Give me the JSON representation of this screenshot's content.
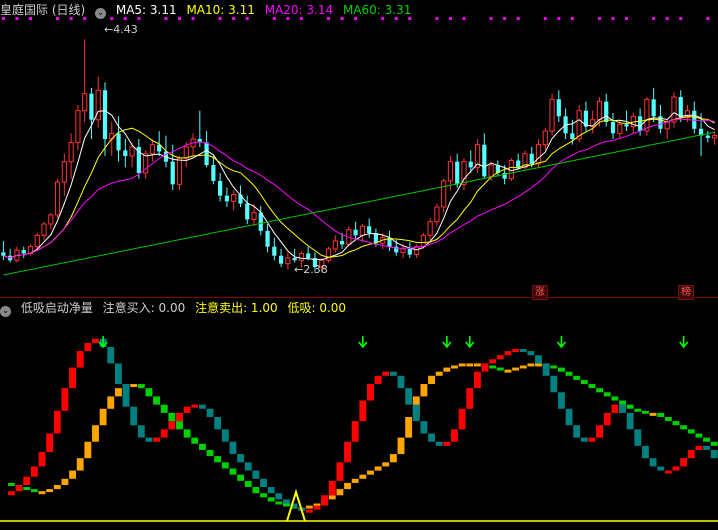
{
  "top_header": {
    "stock_title": "皇庭国际 (日线)",
    "ma5": "MA5: 3.11",
    "ma10": "MA10: 3.11",
    "ma20": "MA20: 3.14",
    "ma60": "MA60: 3.31"
  },
  "bottom_header": {
    "indicator_title": "低吸启动净量",
    "attention_buy": "注意买入: 0.00",
    "attention_sell": "注意卖出: 1.00",
    "low_buy": "低吸: 0.00"
  },
  "annotations": {
    "high_label": "4.43",
    "low_label": "2.38",
    "tag_zhang": "涨",
    "tag_bang": "榜"
  },
  "colors": {
    "up": "#ff3232",
    "down": "#54ffff",
    "ma5": "#ffffff",
    "ma10": "#ffff00",
    "ma20": "#ff00ff",
    "ma60": "#00c000",
    "bg": "#000000",
    "osc_red": "#ff0000",
    "osc_orange": "#ffa500",
    "osc_teal": "#008080",
    "osc_green": "#00d000",
    "arrow": "#00ff00",
    "baseline": "#ffff00"
  },
  "chart_data": [
    {
      "type": "candlestick",
      "ylim": [
        2.2,
        4.6
      ],
      "ma_periods": [
        5,
        10,
        20,
        60
      ],
      "ma_latest": {
        "MA5": 3.11,
        "MA10": 3.11,
        "MA20": 3.14,
        "MA60": 3.31
      },
      "ohlc": [
        [
          2.55,
          2.65,
          2.48,
          2.52
        ],
        [
          2.52,
          2.58,
          2.46,
          2.48
        ],
        [
          2.48,
          2.6,
          2.46,
          2.57
        ],
        [
          2.57,
          2.6,
          2.5,
          2.54
        ],
        [
          2.54,
          2.62,
          2.52,
          2.6
        ],
        [
          2.6,
          2.72,
          2.58,
          2.7
        ],
        [
          2.7,
          2.82,
          2.66,
          2.8
        ],
        [
          2.8,
          2.9,
          2.75,
          2.88
        ],
        [
          2.88,
          3.2,
          2.85,
          3.17
        ],
        [
          3.17,
          3.42,
          3.05,
          3.35
        ],
        [
          3.35,
          3.6,
          3.2,
          3.52
        ],
        [
          3.52,
          3.85,
          3.45,
          3.8
        ],
        [
          3.8,
          4.43,
          3.7,
          3.95
        ],
        [
          3.95,
          4.0,
          3.55,
          3.72
        ],
        [
          3.72,
          4.1,
          3.65,
          3.98
        ],
        [
          3.98,
          4.05,
          3.4,
          3.55
        ],
        [
          3.55,
          3.7,
          3.4,
          3.6
        ],
        [
          3.6,
          3.75,
          3.35,
          3.45
        ],
        [
          3.45,
          3.55,
          3.3,
          3.4
        ],
        [
          3.4,
          3.52,
          3.3,
          3.48
        ],
        [
          3.48,
          3.55,
          3.2,
          3.25
        ],
        [
          3.25,
          3.45,
          3.2,
          3.42
        ],
        [
          3.42,
          3.55,
          3.35,
          3.5
        ],
        [
          3.5,
          3.62,
          3.4,
          3.44
        ],
        [
          3.44,
          3.58,
          3.3,
          3.35
        ],
        [
          3.35,
          3.5,
          3.1,
          3.15
        ],
        [
          3.15,
          3.4,
          3.1,
          3.38
        ],
        [
          3.38,
          3.52,
          3.3,
          3.48
        ],
        [
          3.48,
          3.6,
          3.4,
          3.55
        ],
        [
          3.55,
          3.8,
          3.48,
          3.52
        ],
        [
          3.52,
          3.62,
          3.3,
          3.32
        ],
        [
          3.32,
          3.4,
          3.15,
          3.18
        ],
        [
          3.18,
          3.25,
          3.0,
          3.05
        ],
        [
          3.05,
          3.12,
          2.95,
          3.0
        ],
        [
          3.0,
          3.1,
          2.92,
          3.06
        ],
        [
          3.06,
          3.14,
          2.95,
          2.98
        ],
        [
          2.98,
          3.05,
          2.8,
          2.84
        ],
        [
          2.84,
          2.98,
          2.78,
          2.9
        ],
        [
          2.9,
          2.96,
          2.7,
          2.74
        ],
        [
          2.74,
          2.8,
          2.55,
          2.6
        ],
        [
          2.6,
          2.68,
          2.48,
          2.52
        ],
        [
          2.52,
          2.58,
          2.42,
          2.45
        ],
        [
          2.45,
          2.55,
          2.4,
          2.5
        ],
        [
          2.5,
          2.58,
          2.46,
          2.48
        ],
        [
          2.48,
          2.56,
          2.42,
          2.54
        ],
        [
          2.54,
          2.6,
          2.48,
          2.5
        ],
        [
          2.5,
          2.55,
          2.38,
          2.42
        ],
        [
          2.42,
          2.5,
          2.38,
          2.48
        ],
        [
          2.48,
          2.6,
          2.46,
          2.58
        ],
        [
          2.58,
          2.7,
          2.55,
          2.65
        ],
        [
          2.65,
          2.72,
          2.58,
          2.62
        ],
        [
          2.62,
          2.78,
          2.6,
          2.75
        ],
        [
          2.75,
          2.82,
          2.66,
          2.7
        ],
        [
          2.7,
          2.8,
          2.64,
          2.78
        ],
        [
          2.78,
          2.85,
          2.68,
          2.72
        ],
        [
          2.72,
          2.76,
          2.6,
          2.63
        ],
        [
          2.63,
          2.72,
          2.58,
          2.68
        ],
        [
          2.68,
          2.74,
          2.56,
          2.6
        ],
        [
          2.6,
          2.66,
          2.52,
          2.55
        ],
        [
          2.55,
          2.62,
          2.5,
          2.58
        ],
        [
          2.58,
          2.64,
          2.5,
          2.53
        ],
        [
          2.53,
          2.62,
          2.5,
          2.6
        ],
        [
          2.6,
          2.72,
          2.58,
          2.7
        ],
        [
          2.7,
          2.85,
          2.66,
          2.82
        ],
        [
          2.82,
          2.98,
          2.78,
          2.95
        ],
        [
          2.95,
          3.2,
          2.9,
          3.18
        ],
        [
          3.18,
          3.4,
          3.1,
          3.35
        ],
        [
          3.35,
          3.42,
          3.12,
          3.15
        ],
        [
          3.15,
          3.38,
          3.1,
          3.35
        ],
        [
          3.35,
          3.45,
          3.25,
          3.3
        ],
        [
          3.3,
          3.55,
          3.25,
          3.5
        ],
        [
          3.5,
          3.6,
          3.2,
          3.22
        ],
        [
          3.22,
          3.35,
          3.18,
          3.32
        ],
        [
          3.32,
          3.36,
          3.22,
          3.25
        ],
        [
          3.25,
          3.32,
          3.15,
          3.2
        ],
        [
          3.2,
          3.38,
          3.18,
          3.36
        ],
        [
          3.36,
          3.42,
          3.28,
          3.3
        ],
        [
          3.3,
          3.45,
          3.28,
          3.42
        ],
        [
          3.42,
          3.48,
          3.3,
          3.33
        ],
        [
          3.33,
          3.55,
          3.3,
          3.5
        ],
        [
          3.5,
          3.65,
          3.45,
          3.62
        ],
        [
          3.62,
          3.95,
          3.58,
          3.9
        ],
        [
          3.9,
          3.98,
          3.7,
          3.75
        ],
        [
          3.75,
          3.82,
          3.55,
          3.6
        ],
        [
          3.6,
          3.72,
          3.5,
          3.55
        ],
        [
          3.55,
          3.85,
          3.52,
          3.8
        ],
        [
          3.8,
          3.88,
          3.62,
          3.66
        ],
        [
          3.66,
          3.8,
          3.6,
          3.72
        ],
        [
          3.72,
          3.92,
          3.66,
          3.88
        ],
        [
          3.88,
          3.95,
          3.66,
          3.7
        ],
        [
          3.7,
          3.78,
          3.55,
          3.6
        ],
        [
          3.6,
          3.72,
          3.55,
          3.68
        ],
        [
          3.68,
          3.8,
          3.62,
          3.66
        ],
        [
          3.66,
          3.78,
          3.6,
          3.75
        ],
        [
          3.75,
          3.82,
          3.58,
          3.62
        ],
        [
          3.62,
          3.92,
          3.58,
          3.9
        ],
        [
          3.9,
          4.0,
          3.7,
          3.75
        ],
        [
          3.75,
          3.85,
          3.6,
          3.64
        ],
        [
          3.64,
          3.72,
          3.55,
          3.7
        ],
        [
          3.7,
          3.96,
          3.65,
          3.92
        ],
        [
          3.92,
          3.98,
          3.7,
          3.74
        ],
        [
          3.74,
          3.85,
          3.7,
          3.8
        ],
        [
          3.8,
          3.88,
          3.6,
          3.64
        ],
        [
          3.64,
          3.78,
          3.4,
          3.58
        ],
        [
          3.58,
          3.62,
          3.52,
          3.56
        ],
        [
          3.56,
          3.62,
          3.5,
          3.58
        ]
      ]
    },
    {
      "type": "oscillator",
      "ylim": [
        0,
        100
      ],
      "fast": [
        12,
        14,
        17,
        21,
        26,
        33,
        42,
        53,
        64,
        74,
        82,
        86,
        88,
        84,
        76,
        66,
        55,
        46,
        40,
        38,
        40,
        44,
        48,
        52,
        55,
        56,
        54,
        50,
        44,
        38,
        32,
        28,
        24,
        20,
        16,
        13,
        10,
        8,
        6,
        5,
        5,
        7,
        12,
        19,
        28,
        38,
        48,
        58,
        66,
        70,
        72,
        70,
        64,
        56,
        48,
        42,
        38,
        36,
        38,
        44,
        54,
        64,
        72,
        76,
        78,
        80,
        82,
        83,
        82,
        80,
        76,
        70,
        62,
        54,
        46,
        40,
        38,
        40,
        46,
        52,
        56,
        52,
        44,
        36,
        30,
        26,
        24,
        24,
        26,
        30,
        34,
        36,
        34,
        30
      ],
      "slow": [
        18,
        17,
        16,
        15,
        14,
        14,
        15,
        17,
        20,
        24,
        30,
        38,
        46,
        54,
        60,
        64,
        66,
        66,
        64,
        60,
        56,
        52,
        48,
        44,
        40,
        37,
        34,
        31,
        28,
        25,
        22,
        19,
        16,
        13,
        11,
        9,
        8,
        7,
        6,
        6,
        7,
        8,
        10,
        12,
        15,
        18,
        20,
        22,
        24,
        26,
        28,
        32,
        40,
        50,
        60,
        66,
        70,
        72,
        74,
        75,
        76,
        76,
        76,
        75,
        74,
        73,
        73,
        74,
        75,
        76,
        76,
        75,
        74,
        72,
        70,
        68,
        66,
        64,
        62,
        60,
        58,
        56,
        54,
        53,
        52,
        52,
        50,
        48,
        46,
        44,
        42,
        40,
        38,
        36
      ],
      "buy_arrows_at": [
        13,
        47,
        58,
        61,
        73,
        89
      ]
    }
  ]
}
